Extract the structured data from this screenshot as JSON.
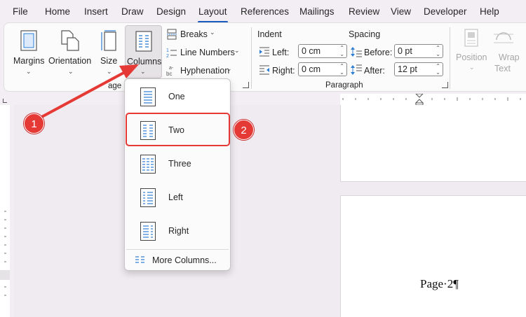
{
  "menu": {
    "items": [
      "File",
      "Home",
      "Insert",
      "Draw",
      "Design",
      "Layout",
      "References",
      "Mailings",
      "Review",
      "View",
      "Developer",
      "Help"
    ],
    "active": "Layout"
  },
  "ribbon": {
    "page_setup": {
      "margins": "Margins",
      "orientation": "Orientation",
      "size": "Size",
      "columns": "Columns",
      "breaks": "Breaks",
      "line_numbers": "Line Numbers",
      "hyphenation": "Hyphenation",
      "group_label_partial": "age S"
    },
    "paragraph": {
      "indent_title": "Indent",
      "spacing_title": "Spacing",
      "left_label": "Left:",
      "right_label": "Right:",
      "before_label": "Before:",
      "after_label": "After:",
      "left_value": "0 cm",
      "right_value": "0 cm",
      "before_value": "0 pt",
      "after_value": "12 pt",
      "group_label": "Paragraph"
    },
    "arrange": {
      "position": "Position",
      "wrap_text_line1": "Wrap",
      "wrap_text_line2": "Text"
    }
  },
  "columns_menu": {
    "options": [
      "One",
      "Two",
      "Three",
      "Left",
      "Right"
    ],
    "more": "More Columns..."
  },
  "annotations": {
    "badge1": "1",
    "badge2": "2",
    "color": "#e53935"
  },
  "document": {
    "page_text": "Page·2¶"
  },
  "colors": {
    "accent": "#185abd",
    "icon_blue": "#2b7cd3"
  }
}
